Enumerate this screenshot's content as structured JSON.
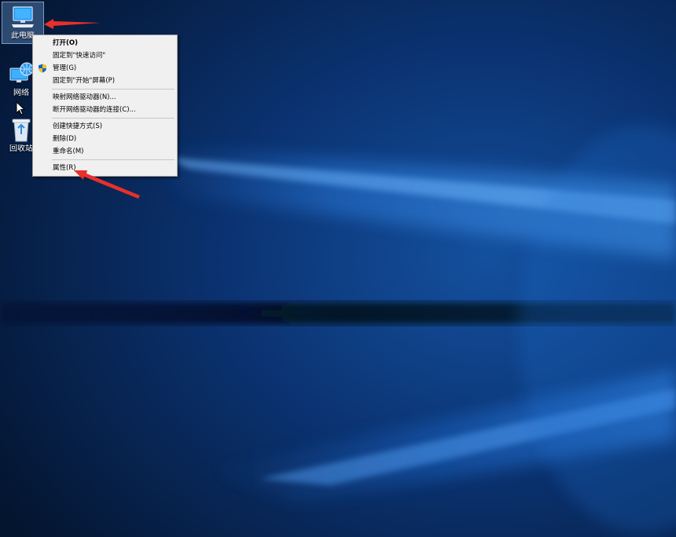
{
  "desktop": {
    "icons": [
      {
        "name": "this-pc",
        "label": "此电脑",
        "selected": true
      },
      {
        "name": "network",
        "label": "网络",
        "selected": false
      },
      {
        "name": "recycle-bin",
        "label": "回收站",
        "selected": false
      }
    ]
  },
  "context_menu": {
    "items": [
      {
        "label": "打开(O)",
        "bold": true,
        "icon": ""
      },
      {
        "label": "固定到\"快速访问\"",
        "bold": false,
        "icon": ""
      },
      {
        "label": "管理(G)",
        "bold": false,
        "icon": "uac-shield-icon"
      },
      {
        "label": "固定到\"开始\"屏幕(P)",
        "bold": false,
        "icon": ""
      },
      {
        "label": "映射网络驱动器(N)...",
        "bold": false,
        "icon": ""
      },
      {
        "label": "断开网络驱动器的连接(C)...",
        "bold": false,
        "icon": ""
      },
      {
        "label": "创建快捷方式(S)",
        "bold": false,
        "icon": ""
      },
      {
        "label": "删除(D)",
        "bold": false,
        "icon": ""
      },
      {
        "label": "重命名(M)",
        "bold": false,
        "icon": ""
      },
      {
        "label": "属性(R)",
        "bold": false,
        "icon": ""
      }
    ]
  },
  "annotations": {
    "arrow_color": "#e8302a"
  },
  "colors": {
    "wallpaper_dark": "#041530",
    "wallpaper_light": "#1f78d8",
    "menu_bg": "#f0f0f0"
  }
}
